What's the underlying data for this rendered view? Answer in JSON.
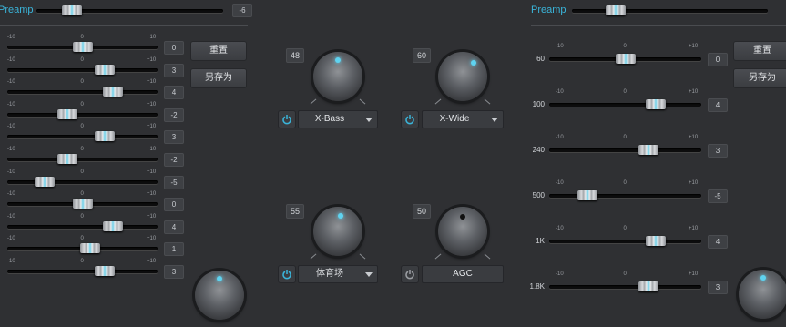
{
  "left_panel": {
    "preamp_label": "Preamp",
    "preamp_value": "-6",
    "tick_min": "-10",
    "tick_mid": "0",
    "tick_max": "+10",
    "bands": [
      {
        "value": "0",
        "pos": 0
      },
      {
        "value": "3",
        "pos": 3
      },
      {
        "value": "4",
        "pos": 4
      },
      {
        "value": "-2",
        "pos": -2
      },
      {
        "value": "3",
        "pos": 3
      },
      {
        "value": "-2",
        "pos": -2
      },
      {
        "value": "-5",
        "pos": -5
      },
      {
        "value": "0",
        "pos": 0
      },
      {
        "value": "4",
        "pos": 4
      },
      {
        "value": "1",
        "pos": 1
      },
      {
        "value": "3",
        "pos": 3
      }
    ],
    "reset_label": "重置",
    "save_as_label": "另存为"
  },
  "center": {
    "xbass": {
      "value": "48",
      "label": "X-Bass",
      "active": true
    },
    "xwide": {
      "value": "60",
      "label": "X-Wide",
      "active": true
    },
    "stadium": {
      "value": "55",
      "label": "体育场",
      "active": true
    },
    "agc": {
      "value": "50",
      "label": "AGC",
      "active": false
    }
  },
  "right_panel": {
    "preamp_label": "Preamp",
    "tick_min": "-10",
    "tick_mid": "0",
    "tick_max": "+10",
    "bands": [
      {
        "freq": "60",
        "value": "0",
        "pos": 0
      },
      {
        "freq": "100",
        "value": "4",
        "pos": 4
      },
      {
        "freq": "240",
        "value": "3",
        "pos": 3
      },
      {
        "freq": "500",
        "value": "-5",
        "pos": -5
      },
      {
        "freq": "1K",
        "value": "4",
        "pos": 4
      },
      {
        "freq": "1.8K",
        "value": "3",
        "pos": 3
      }
    ],
    "reset_label": "重置",
    "save_as_label": "另存为"
  },
  "colors": {
    "accent": "#3ab4d9",
    "knob_dot_active": "#5fd3f0",
    "knob_dot_inactive": "#111111"
  }
}
